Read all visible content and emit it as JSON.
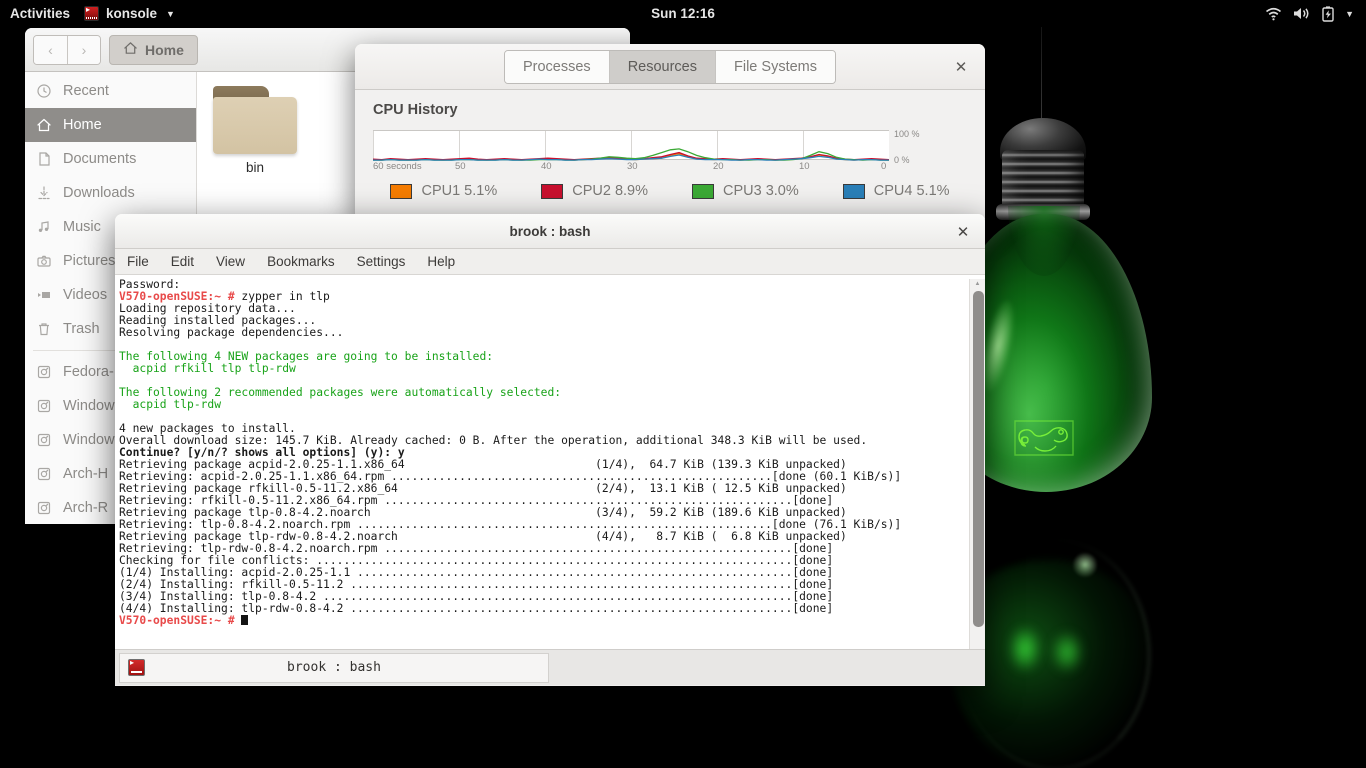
{
  "topbar": {
    "activities": "Activities",
    "app_name": "konsole",
    "app_icon": "konsole-icon",
    "clock": "Sun 12:16",
    "tray": [
      {
        "name": "wifi-icon",
        "label": "WiFi"
      },
      {
        "name": "volume-icon",
        "label": "Volume"
      },
      {
        "name": "battery-charging-icon",
        "label": "Battery charging"
      },
      {
        "name": "chevron-down-icon",
        "label": "System menu"
      }
    ]
  },
  "file_manager": {
    "back_label": "‹",
    "forward_label": "›",
    "path_button": "Home",
    "sidebar": [
      {
        "label": "Recent",
        "icon": "clock-icon",
        "active": false
      },
      {
        "label": "Home",
        "icon": "home-icon",
        "active": true
      },
      {
        "label": "Documents",
        "icon": "document-icon",
        "active": false
      },
      {
        "label": "Downloads",
        "icon": "download-icon",
        "active": false
      },
      {
        "label": "Music",
        "icon": "music-icon",
        "active": false
      },
      {
        "label": "Pictures",
        "icon": "camera-icon",
        "active": false
      },
      {
        "label": "Videos",
        "icon": "video-icon",
        "active": false
      },
      {
        "label": "Trash",
        "icon": "trash-icon",
        "active": false
      },
      {
        "label": "Fedora-",
        "icon": "disk-icon",
        "active": false
      },
      {
        "label": "Window",
        "icon": "disk-icon",
        "active": false
      },
      {
        "label": "Window",
        "icon": "disk-icon",
        "active": false
      },
      {
        "label": "Arch-H",
        "icon": "disk-icon",
        "active": false
      },
      {
        "label": "Arch-R",
        "icon": "disk-icon",
        "active": false
      }
    ],
    "files": [
      {
        "name": "bin",
        "icon": "folder-icon"
      }
    ]
  },
  "system_monitor": {
    "tabs": [
      {
        "label": "Processes",
        "active": false
      },
      {
        "label": "Resources",
        "active": true
      },
      {
        "label": "File Systems",
        "active": false
      }
    ],
    "close_label": "✕",
    "section_title": "CPU History"
  },
  "chart_data": {
    "type": "line",
    "title": "CPU History",
    "xlabel": "60 seconds",
    "ylabel": "",
    "ylim": [
      0,
      100
    ],
    "y_ticks": [
      "100 %",
      "0 %"
    ],
    "x_ticks": [
      "60 seconds",
      "50",
      "40",
      "30",
      "20",
      "10",
      "0"
    ],
    "grid": true,
    "legend_position": "bottom",
    "series": [
      {
        "name": "CPU1",
        "value_label": "5.1%",
        "color": "#f57c00",
        "values": [
          3,
          2,
          4,
          3,
          2,
          3,
          4,
          3,
          2,
          3,
          4,
          5,
          3,
          2,
          3,
          4,
          3,
          2,
          3,
          4,
          5,
          4,
          3,
          2,
          3,
          4,
          5,
          6,
          5,
          4,
          3,
          4,
          5,
          6,
          12,
          16,
          9,
          5,
          4,
          3,
          4,
          3,
          2,
          3,
          4,
          3,
          2,
          3,
          4,
          5,
          8,
          13,
          10,
          5,
          3,
          2,
          3,
          4,
          3,
          2
        ]
      },
      {
        "name": "CPU2",
        "value_label": "8.9%",
        "color": "#c8102e",
        "values": [
          4,
          3,
          5,
          4,
          3,
          4,
          5,
          4,
          3,
          4,
          5,
          6,
          4,
          3,
          4,
          5,
          4,
          3,
          4,
          5,
          6,
          5,
          4,
          3,
          4,
          5,
          6,
          7,
          6,
          5,
          4,
          5,
          7,
          9,
          14,
          18,
          11,
          6,
          5,
          4,
          5,
          4,
          3,
          4,
          5,
          4,
          3,
          4,
          5,
          6,
          9,
          14,
          11,
          6,
          4,
          3,
          4,
          5,
          4,
          3
        ]
      },
      {
        "name": "CPU3",
        "value_label": "3.0%",
        "color": "#3ba935",
        "values": [
          2,
          2,
          3,
          2,
          2,
          2,
          3,
          2,
          2,
          2,
          3,
          3,
          2,
          2,
          2,
          3,
          2,
          2,
          2,
          3,
          3,
          3,
          2,
          2,
          3,
          4,
          6,
          9,
          8,
          6,
          5,
          7,
          12,
          18,
          24,
          26,
          20,
          12,
          7,
          4,
          3,
          3,
          2,
          2,
          3,
          3,
          2,
          2,
          3,
          5,
          12,
          20,
          16,
          8,
          4,
          3,
          2,
          3,
          2,
          2
        ]
      },
      {
        "name": "CPU4",
        "value_label": "5.1%",
        "color": "#2a7fb8",
        "values": [
          2,
          2,
          3,
          2,
          2,
          2,
          3,
          2,
          2,
          2,
          3,
          3,
          2,
          2,
          2,
          3,
          2,
          2,
          3,
          4,
          3,
          3,
          2,
          2,
          3,
          3,
          4,
          5,
          4,
          3,
          3,
          4,
          5,
          6,
          10,
          13,
          8,
          4,
          3,
          3,
          3,
          2,
          2,
          3,
          3,
          2,
          2,
          3,
          4,
          5,
          7,
          10,
          8,
          4,
          3,
          2,
          3,
          3,
          2,
          2
        ]
      }
    ]
  },
  "konsole": {
    "title": "brook : bash",
    "close_label": "✕",
    "menu": [
      "File",
      "Edit",
      "View",
      "Bookmarks",
      "Settings",
      "Help"
    ],
    "tab": {
      "label": "brook : bash",
      "icon": "konsole-icon"
    },
    "prompt": "V570-openSUSE:~ #",
    "lines": [
      {
        "segments": [
          {
            "t": "Password:",
            "c": "plain"
          }
        ]
      },
      {
        "segments": [
          {
            "t": "V570-openSUSE:~ #",
            "c": "red"
          },
          {
            "t": " zypper in tlp",
            "c": "plain"
          }
        ]
      },
      {
        "segments": [
          {
            "t": "Loading repository data...",
            "c": "plain"
          }
        ]
      },
      {
        "segments": [
          {
            "t": "Reading installed packages...",
            "c": "plain"
          }
        ]
      },
      {
        "segments": [
          {
            "t": "Resolving package dependencies...",
            "c": "plain"
          }
        ]
      },
      {
        "segments": [
          {
            "t": "",
            "c": "plain"
          }
        ]
      },
      {
        "segments": [
          {
            "t": "The following 4 NEW packages are going to be installed:",
            "c": "green"
          }
        ]
      },
      {
        "segments": [
          {
            "t": "  acpid rfkill tlp tlp-rdw",
            "c": "green"
          }
        ]
      },
      {
        "segments": [
          {
            "t": "",
            "c": "plain"
          }
        ]
      },
      {
        "segments": [
          {
            "t": "The following 2 recommended packages were automatically selected:",
            "c": "green"
          }
        ]
      },
      {
        "segments": [
          {
            "t": "  acpid tlp-rdw",
            "c": "green"
          }
        ]
      },
      {
        "segments": [
          {
            "t": "",
            "c": "plain"
          }
        ]
      },
      {
        "segments": [
          {
            "t": "4 new packages to install.",
            "c": "plain"
          }
        ]
      },
      {
        "segments": [
          {
            "t": "Overall download size: 145.7 KiB. Already cached: 0 B. After the operation, additional 348.3 KiB will be used.",
            "c": "plain"
          }
        ]
      },
      {
        "segments": [
          {
            "t": "Continue? [y/n/? shows all options] (y): y",
            "c": "bold"
          }
        ]
      },
      {
        "segments": [
          {
            "t": "Retrieving package acpid-2.0.25-1.1.x86_64                            (1/4),  64.7 KiB (139.3 KiB unpacked)",
            "c": "plain"
          }
        ]
      },
      {
        "segments": [
          {
            "t": "Retrieving: acpid-2.0.25-1.1.x86_64.rpm ........................................................[done (60.1 KiB/s)]",
            "c": "plain"
          }
        ]
      },
      {
        "segments": [
          {
            "t": "Retrieving package rfkill-0.5-11.2.x86_64                             (2/4),  13.1 KiB ( 12.5 KiB unpacked)",
            "c": "plain"
          }
        ]
      },
      {
        "segments": [
          {
            "t": "Retrieving: rfkill-0.5-11.2.x86_64.rpm ............................................................[done]",
            "c": "plain"
          }
        ]
      },
      {
        "segments": [
          {
            "t": "Retrieving package tlp-0.8-4.2.noarch                                 (3/4),  59.2 KiB (189.6 KiB unpacked)",
            "c": "plain"
          }
        ]
      },
      {
        "segments": [
          {
            "t": "Retrieving: tlp-0.8-4.2.noarch.rpm .............................................................[done (76.1 KiB/s)]",
            "c": "plain"
          }
        ]
      },
      {
        "segments": [
          {
            "t": "Retrieving package tlp-rdw-0.8-4.2.noarch                             (4/4),   8.7 KiB (  6.8 KiB unpacked)",
            "c": "plain"
          }
        ]
      },
      {
        "segments": [
          {
            "t": "Retrieving: tlp-rdw-0.8-4.2.noarch.rpm ............................................................[done]",
            "c": "plain"
          }
        ]
      },
      {
        "segments": [
          {
            "t": "Checking for file conflicts: ......................................................................[done]",
            "c": "plain"
          }
        ]
      },
      {
        "segments": [
          {
            "t": "(1/4) Installing: acpid-2.0.25-1.1 ................................................................[done]",
            "c": "plain"
          }
        ]
      },
      {
        "segments": [
          {
            "t": "(2/4) Installing: rfkill-0.5-11.2 .................................................................[done]",
            "c": "plain"
          }
        ]
      },
      {
        "segments": [
          {
            "t": "(3/4) Installing: tlp-0.8-4.2 .....................................................................[done]",
            "c": "plain"
          }
        ]
      },
      {
        "segments": [
          {
            "t": "(4/4) Installing: tlp-rdw-0.8-4.2 .................................................................[done]",
            "c": "plain"
          }
        ]
      },
      {
        "segments": [
          {
            "t": "V570-openSUSE:~ #",
            "c": "red"
          },
          {
            "t": " ",
            "c": "plain"
          },
          {
            "t": "█",
            "c": "cursor"
          }
        ]
      }
    ]
  }
}
